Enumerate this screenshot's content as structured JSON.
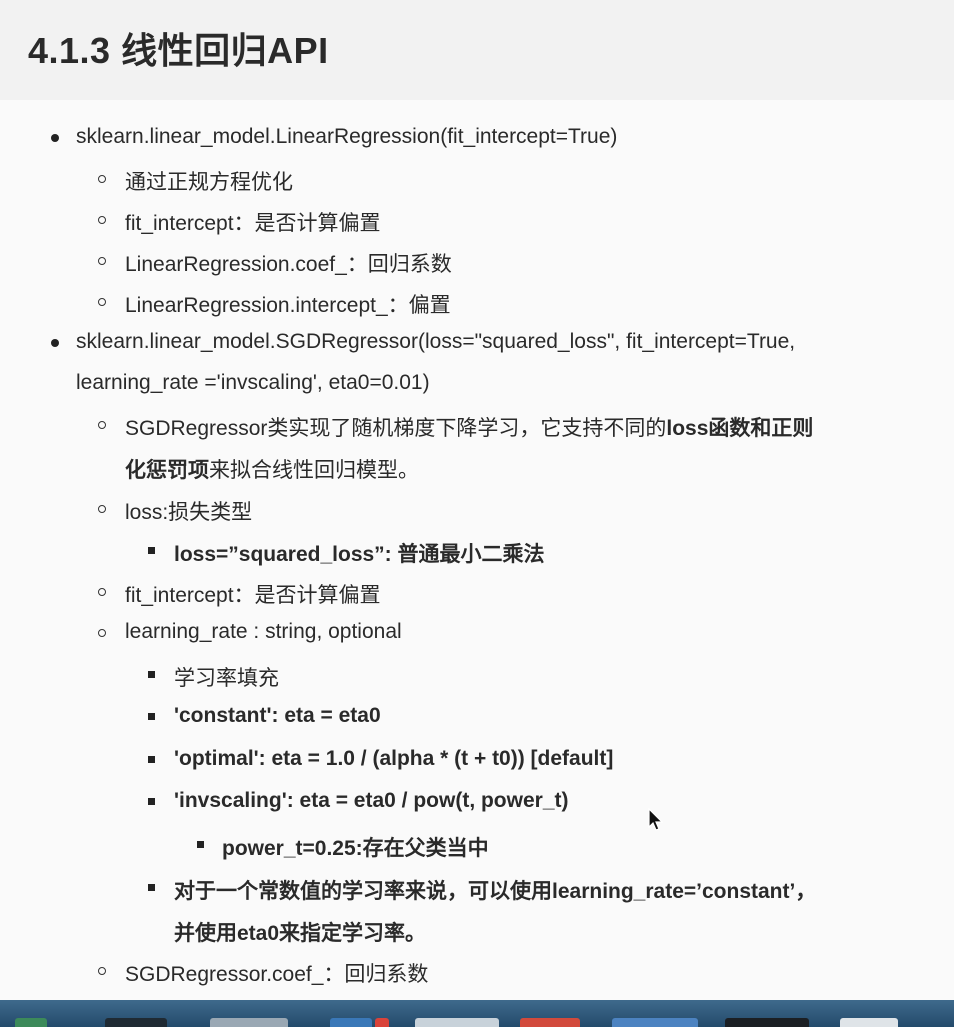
{
  "title": "4.1.3 线性回归API",
  "items": [
    {
      "text": "sklearn.linear_model.LinearRegression(fit_intercept=True)"
    },
    {
      "text": "通过正规方程优化"
    },
    {
      "text": "fit_intercept：是否计算偏置"
    },
    {
      "text": "LinearRegression.coef_：回归系数"
    },
    {
      "text": "LinearRegression.intercept_：偏置"
    },
    {
      "text": "sklearn.linear_model.SGDRegressor(loss=\"squared_loss\", fit_intercept=True,"
    },
    {
      "text": "learning_rate ='invscaling', eta0=0.01)"
    },
    {
      "prefix": "SGDRegressor类实现了随机梯度下降学习，它支持不同的",
      "bold": "loss函数和正则"
    },
    {
      "bold": "化惩罚项",
      "suffix": "来拟合线性回归模型。"
    },
    {
      "text": "loss:损失类型"
    },
    {
      "bold": "loss=”squared_loss”: 普通最小二乘法"
    },
    {
      "text": "fit_intercept：是否计算偏置"
    },
    {
      "text": "learning_rate : string, optional"
    },
    {
      "text": "学习率填充"
    },
    {
      "bold": "'constant': eta = eta0"
    },
    {
      "bold": "'optimal': eta = 1.0 / (alpha * (t + t0)) [default]"
    },
    {
      "bold": "'invscaling': eta = eta0 / pow(t, power_t)"
    },
    {
      "bold": "power_t=0.25:存在父类当中"
    },
    {
      "bold": "对于一个常数值的学习率来说，可以使用learning_rate=’constant’，"
    },
    {
      "bold": "并使用eta0来指定学习率。"
    },
    {
      "text": "SGDRegressor.coef_：回归系数"
    }
  ],
  "colors": {
    "text": "#2a2a2a",
    "background": "#fafafa",
    "taskbar": "#2f5a7c"
  }
}
